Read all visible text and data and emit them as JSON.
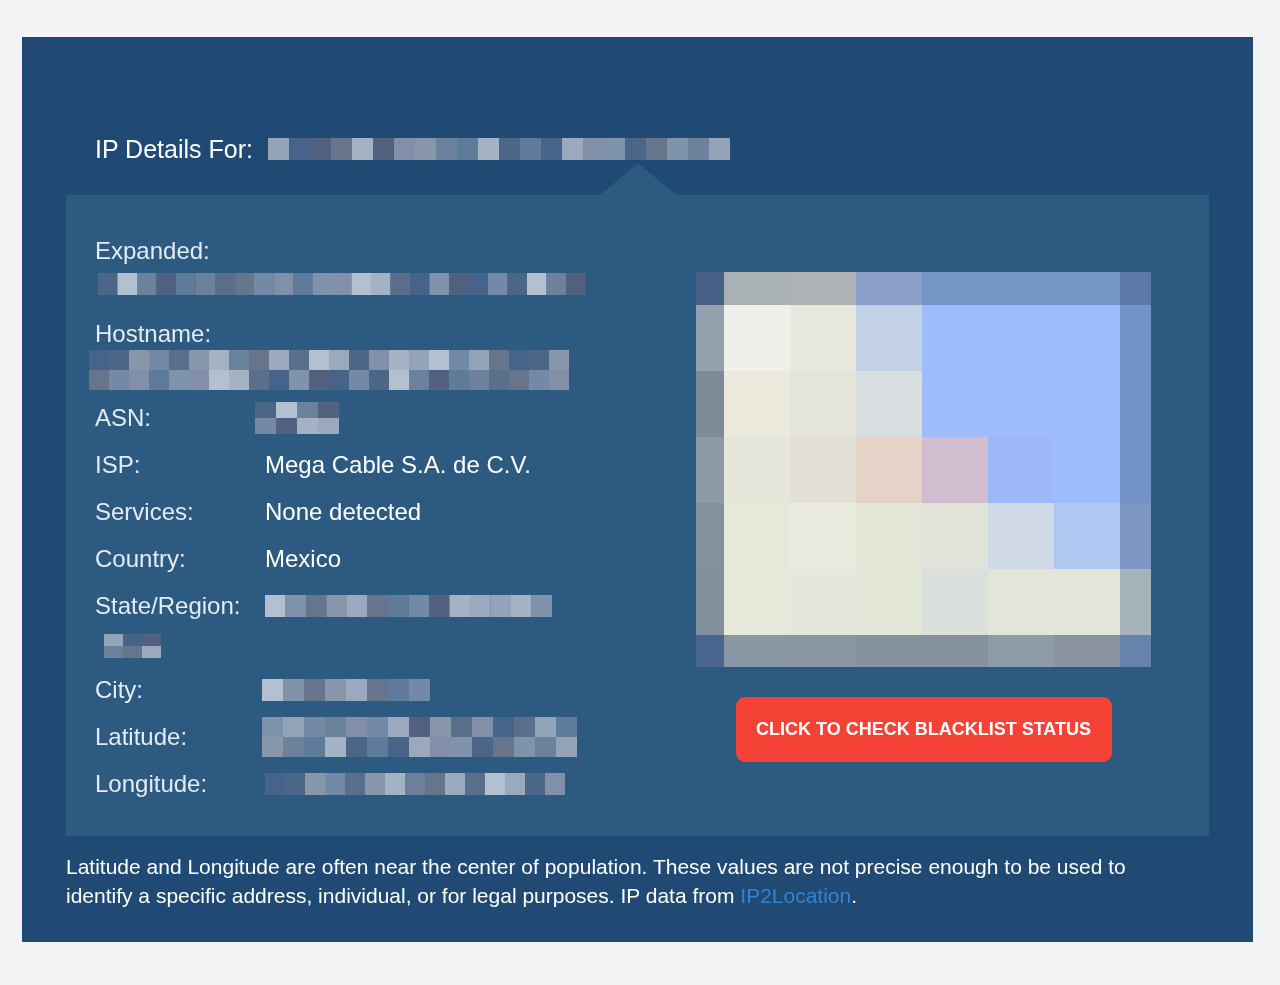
{
  "heading": {
    "label": "IP Details For:",
    "redacted": true
  },
  "details": [
    {
      "label": "Expanded:",
      "kind": "stacked",
      "redacted": true
    },
    {
      "label": "Hostname:",
      "kind": "stacked",
      "redacted": true
    },
    {
      "label": "ASN:",
      "kind": "inline",
      "redacted": true
    },
    {
      "label": "ISP:",
      "kind": "inline",
      "redacted": false,
      "value": "Mega Cable S.A. de C.V."
    },
    {
      "label": "Services:",
      "kind": "inline",
      "redacted": false,
      "value": "None detected"
    },
    {
      "label": "Country:",
      "kind": "inline",
      "redacted": false,
      "value": "Mexico"
    },
    {
      "label": "State/Region:",
      "kind": "wrapped",
      "redacted": true
    },
    {
      "label": "City:",
      "kind": "inline",
      "redacted": true
    },
    {
      "label": "Latitude:",
      "kind": "inline",
      "redacted": true
    },
    {
      "label": "Longitude:",
      "kind": "inline",
      "redacted": true
    }
  ],
  "blacklist_button": {
    "label": "CLICK TO CHECK BLACKLIST STATUS"
  },
  "disclaimer": {
    "text": "Latitude and Longitude are often near the center of population. These values are not precise enough to be used to identify a specific address, individual, or for legal purposes. IP data from ",
    "link": "IP2Location",
    "end": "."
  }
}
